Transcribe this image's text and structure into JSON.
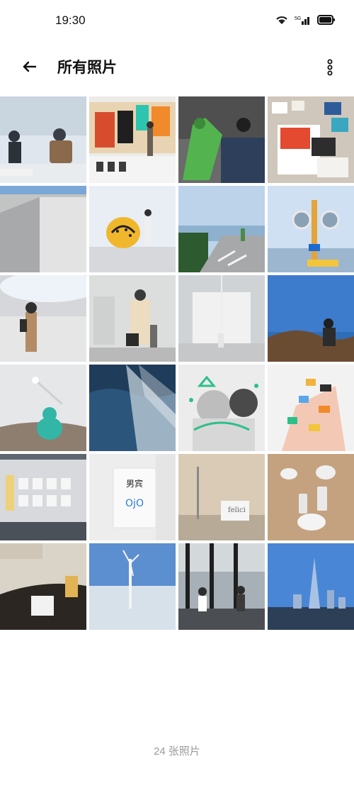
{
  "status": {
    "time": "19:30"
  },
  "header": {
    "title": "所有照片"
  },
  "tiles": [
    {
      "label": "cafe-table-two-people"
    },
    {
      "label": "gallery-posters"
    },
    {
      "label": "green-hoodie-sofa-dog"
    },
    {
      "label": "magazines-table"
    },
    {
      "label": "concrete-wall-shadow"
    },
    {
      "label": "yellow-pumpkin-sculpture"
    },
    {
      "label": "coastal-road"
    },
    {
      "label": "road-mirror-seaside"
    },
    {
      "label": "oval-opening-museum"
    },
    {
      "label": "luggage-white-gallery"
    },
    {
      "label": "white-room-light"
    },
    {
      "label": "hiker-hill-blue-sky"
    },
    {
      "label": "green-plush-sofa-lamp"
    },
    {
      "label": "ocean-waves"
    },
    {
      "label": "vintage-photo-stickers"
    },
    {
      "label": "hand-stickers"
    },
    {
      "label": "wall-signs-gray"
    },
    {
      "label": "restroom-sign"
    },
    {
      "label": "floor-lamp-room"
    },
    {
      "label": "glassware-table"
    },
    {
      "label": "leather-sofa-pillow"
    },
    {
      "label": "wind-turbine-fog"
    },
    {
      "label": "shop-window-people"
    },
    {
      "label": "tower-skyline"
    }
  ],
  "footer": {
    "count_text": "24 张照片"
  }
}
